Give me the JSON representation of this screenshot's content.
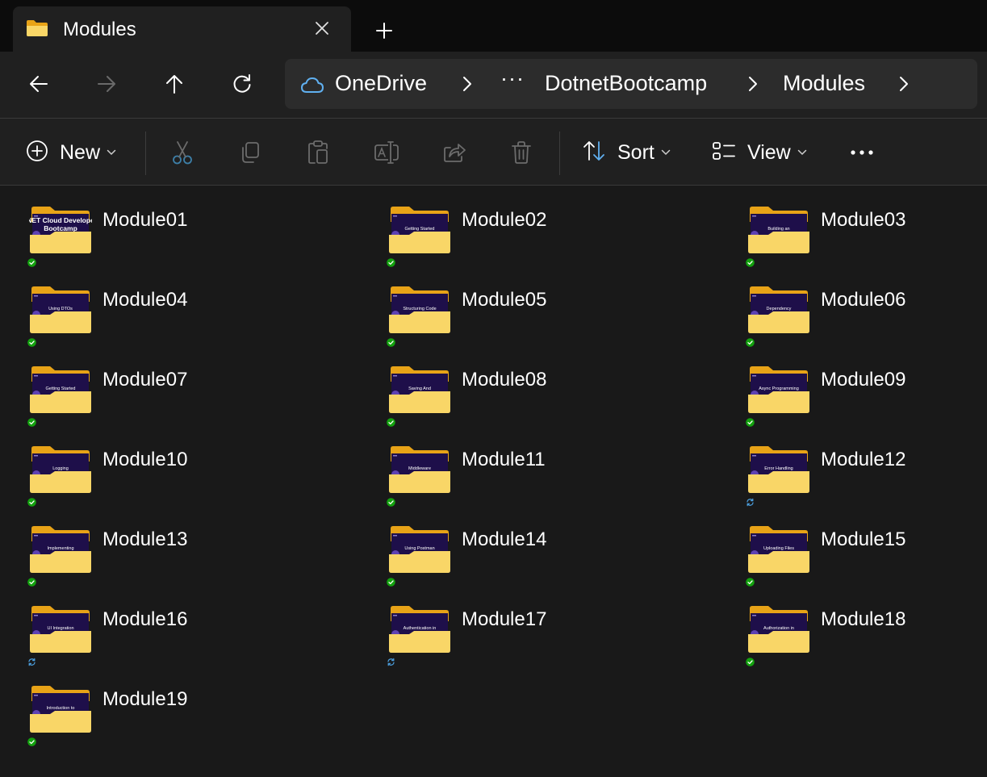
{
  "tab": {
    "title": "Modules"
  },
  "address": {
    "root": "OneDrive",
    "ellipsis": "···",
    "segment1": "DotnetBootcamp",
    "segment2": "Modules"
  },
  "commands": {
    "new": "New",
    "sort": "Sort",
    "view": "View"
  },
  "icons": {
    "folder_back": "#e8a317",
    "folder_front": "#f9d667",
    "thumb_bg": "#1e0f4a",
    "synced": "#13a10e",
    "syncing": "#4ca0e0",
    "cloud": "#60b0f0"
  },
  "items": [
    {
      "name": "Module01",
      "thumb": "NET Cloud Develope\nBootcamp",
      "status": "synced"
    },
    {
      "name": "Module02",
      "thumb": "Getting Started",
      "status": "synced"
    },
    {
      "name": "Module03",
      "thumb": "Building an",
      "status": "synced"
    },
    {
      "name": "Module04",
      "thumb": "Using DTOs",
      "status": "synced"
    },
    {
      "name": "Module05",
      "thumb": "Structuring Code",
      "status": "synced"
    },
    {
      "name": "Module06",
      "thumb": "Dependency",
      "status": "synced"
    },
    {
      "name": "Module07",
      "thumb": "Getting Started",
      "status": "synced"
    },
    {
      "name": "Module08",
      "thumb": "Saving And",
      "status": "synced"
    },
    {
      "name": "Module09",
      "thumb": "Async Programming",
      "status": "synced"
    },
    {
      "name": "Module10",
      "thumb": "Logging",
      "status": "synced"
    },
    {
      "name": "Module11",
      "thumb": "Middleware",
      "status": "synced"
    },
    {
      "name": "Module12",
      "thumb": "Error Handling",
      "status": "syncing"
    },
    {
      "name": "Module13",
      "thumb": "Implementing",
      "status": "synced"
    },
    {
      "name": "Module14",
      "thumb": "Using Postman",
      "status": "synced"
    },
    {
      "name": "Module15",
      "thumb": "Uploading Files",
      "status": "synced"
    },
    {
      "name": "Module16",
      "thumb": "UI Integration",
      "status": "syncing"
    },
    {
      "name": "Module17",
      "thumb": "Authentication in",
      "status": "syncing"
    },
    {
      "name": "Module18",
      "thumb": "Authorization in",
      "status": "synced"
    },
    {
      "name": "Module19",
      "thumb": "Introduction to",
      "status": "synced"
    }
  ]
}
